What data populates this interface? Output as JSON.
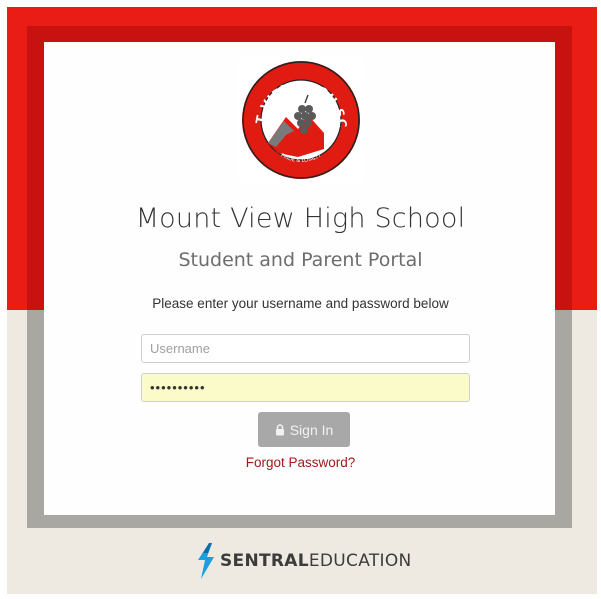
{
  "logo": {
    "arc_text": "MOUNT VIEW HIGH SCHOOL",
    "motto": "PRIDE & LOYALTY"
  },
  "school_name": "Mount View High School",
  "portal_name": "Student and Parent Portal",
  "instructions": "Please enter your username and password below",
  "username": {
    "placeholder": "Username",
    "value": ""
  },
  "password": {
    "value": "••••••••••"
  },
  "signin": {
    "label": "Sign In",
    "icon": "lock-icon"
  },
  "forgot_password": "Forgot Password?",
  "footer_brand": {
    "bold": "SENTRAL",
    "regular": "EDUCATION"
  },
  "colors": {
    "brand_red": "#ea1c16",
    "link_red": "#a31919",
    "sentral_blue": "#1b9fe0",
    "button_gray": "#a8a8a8",
    "password_fill": "#fbfbc9"
  }
}
